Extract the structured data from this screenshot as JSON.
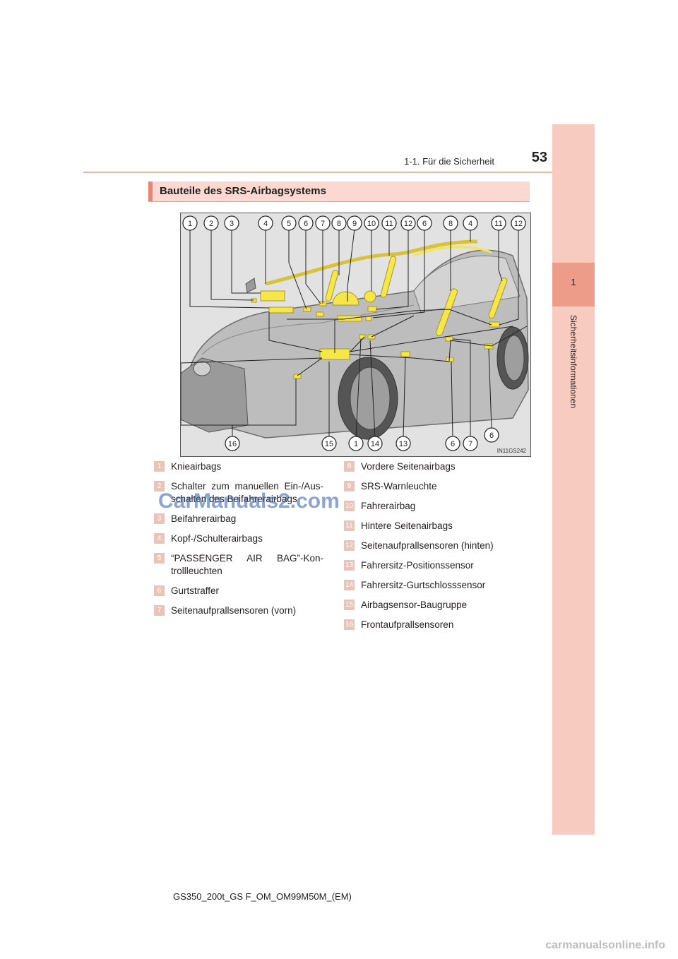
{
  "header": {
    "title": "1-1. Für die Sicherheit",
    "page_number": "53"
  },
  "side_tab": {
    "chapter_number": "1",
    "label": "Sicherheitsinformationen"
  },
  "section": {
    "title": "Bauteile des SRS-Airbagsystems"
  },
  "figure": {
    "code": "IN11GS242",
    "callouts_top": [
      "1",
      "2",
      "3",
      "4",
      "5",
      "6",
      "7",
      "8",
      "9",
      "10",
      "11",
      "12",
      "6",
      "8",
      "4",
      "11",
      "12"
    ],
    "callouts_bottom": [
      "16",
      "15",
      "1",
      "14",
      "13",
      "6",
      "7",
      "6"
    ]
  },
  "legend": {
    "left": [
      {
        "num": "1",
        "text": "Knieairbags"
      },
      {
        "num": "2",
        "text": "Schalter zum manuellen Ein-/Aus-schalten des Beifahrerairbags"
      },
      {
        "num": "3",
        "text": "Beifahrerairbag"
      },
      {
        "num": "4",
        "text": "Kopf-/Schulterairbags"
      },
      {
        "num": "5",
        "text": "“PASSENGER AIR BAG”-Kon-trollleuchten"
      },
      {
        "num": "6",
        "text": "Gurtstraffer"
      },
      {
        "num": "7",
        "text": "Seitenaufprallsensoren (vorn)"
      }
    ],
    "right": [
      {
        "num": "8",
        "text": "Vordere Seitenairbags"
      },
      {
        "num": "9",
        "text": "SRS-Warnleuchte"
      },
      {
        "num": "10",
        "text": "Fahrerairbag"
      },
      {
        "num": "11",
        "text": "Hintere Seitenairbags"
      },
      {
        "num": "12",
        "text": "Seitenaufprallsensoren (hinten)"
      },
      {
        "num": "13",
        "text": "Fahrersitz-Positionssensor"
      },
      {
        "num": "14",
        "text": "Fahrersitz-Gurtschlosssensor"
      },
      {
        "num": "15",
        "text": "Airbagsensor-Baugruppe"
      },
      {
        "num": "16",
        "text": "Frontaufprallsensoren"
      }
    ]
  },
  "watermark": "CarManuals2.com",
  "footer": {
    "code": "GS350_200t_GS F_OM_OM99M50M_(EM)",
    "site": "carmanualsonline.info"
  },
  "colors": {
    "accent": "#e98570",
    "band": "#f8cbc0",
    "airbag": "#f5e64a"
  }
}
